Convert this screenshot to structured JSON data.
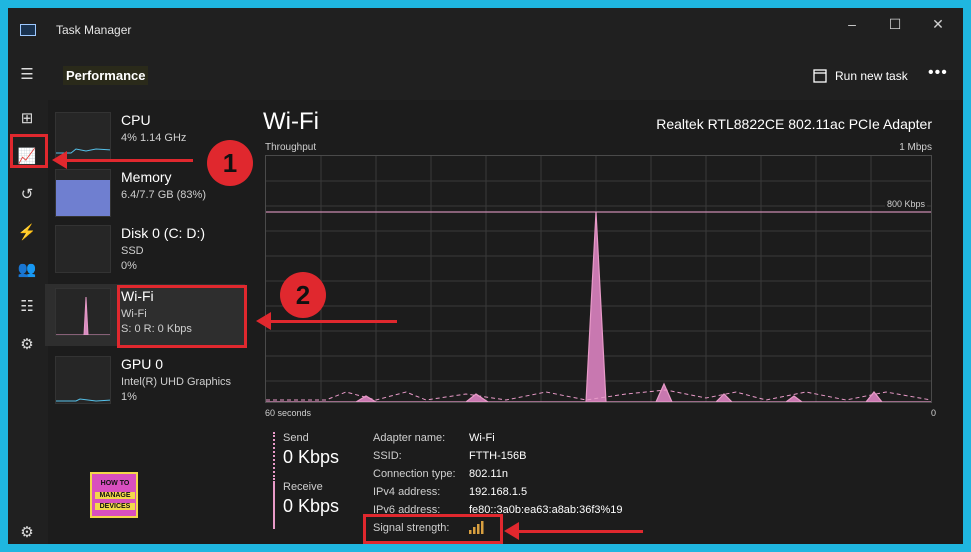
{
  "window": {
    "title": "Task Manager",
    "controls": [
      "–",
      "☐",
      "✕"
    ]
  },
  "sidebar": {
    "items": [
      {
        "name": "menu",
        "glyph": "☰"
      },
      {
        "name": "processes",
        "glyph": "⊞"
      },
      {
        "name": "performance",
        "glyph": "📈"
      },
      {
        "name": "app-history",
        "glyph": "↺"
      },
      {
        "name": "startup-apps",
        "glyph": "⚡"
      },
      {
        "name": "users",
        "glyph": "👥"
      },
      {
        "name": "details",
        "glyph": "☷"
      },
      {
        "name": "services",
        "glyph": "⚙"
      }
    ],
    "settings_glyph": "⚙"
  },
  "header": {
    "title": "Performance",
    "run_task_label": "Run new task",
    "more_label": "•••"
  },
  "devices": [
    {
      "name": "CPU",
      "line1": "4% 1.14 GHz",
      "line2": ""
    },
    {
      "name": "Memory",
      "line1": "6.4/7.7 GB (83%)",
      "line2": ""
    },
    {
      "name": "Disk 0 (C: D:)",
      "line1": "SSD",
      "line2": "0%"
    },
    {
      "name": "Wi-Fi",
      "line1": "Wi-Fi",
      "line2": "S: 0 R: 0 Kbps"
    },
    {
      "name": "GPU 0",
      "line1": "Intel(R) UHD Graphics",
      "line2": "1%"
    }
  ],
  "main": {
    "title": "Wi-Fi",
    "adapter": "Realtek RTL8822CE 802.11ac PCIe Adapter",
    "throughput_label": "Throughput",
    "max_label": "1 Mbps",
    "ref_line_label": "800 Kbps",
    "time_left": "60 seconds",
    "time_right": "0",
    "send": {
      "label": "Send",
      "value": "0 Kbps"
    },
    "receive": {
      "label": "Receive",
      "value": "0 Kbps"
    },
    "properties": [
      {
        "label": "Adapter name:",
        "value": "Wi-Fi"
      },
      {
        "label": "SSID:",
        "value": "FTTH-156B"
      },
      {
        "label": "Connection type:",
        "value": "802.11n"
      },
      {
        "label": "IPv4 address:",
        "value": "192.168.1.5"
      },
      {
        "label": "IPv6 address:",
        "value": "fe80::3a0b:ea63:a8ab:36f3%19"
      },
      {
        "label": "Signal strength:",
        "value": ""
      }
    ]
  },
  "annotations": {
    "badge1": "1",
    "badge2": "2"
  },
  "logo": {
    "line1": "HOW TO",
    "line2": "MANAGE",
    "line3": "DEVICES"
  },
  "colors": {
    "accent": "#e89ac8",
    "highlight": "#e0282e",
    "bg": "#1fb6e0"
  }
}
